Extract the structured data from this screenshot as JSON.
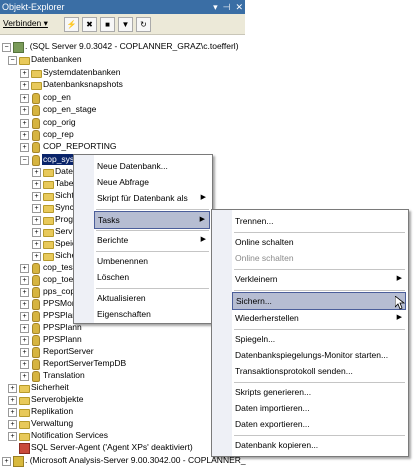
{
  "window": {
    "title": "Objekt-Explorer",
    "pin_icon": "pin-icon",
    "close_icon": "close-icon"
  },
  "toolbar": {
    "connect_label": "Verbinden ▾"
  },
  "tree": {
    "server": ". (SQL Server 9.0.3042 - COPLANNER_GRAZ\\c.toefferl)",
    "datenbanken": "Datenbanken",
    "systemdatenbanken": "Systemdatenbanken",
    "snapshots": "Datenbanksnapshots",
    "cop_en": "cop_en",
    "cop_en_stage": "cop_en_stage",
    "cop_orig": "cop_orig",
    "cop_rep": "cop_rep",
    "cop_reporting": "COP_REPORTING",
    "cop_sys": "cop_sys",
    "c1": "Date",
    "c2": "Tabe",
    "c3": "Sicht",
    "c4": "Sync",
    "c5": "Prog",
    "c6": "Serv",
    "c7": "Speic",
    "c8": "Siche",
    "cop_test": "cop_test",
    "cop_toef": "cop_toef",
    "pps_cop": "pps_cop",
    "ppsmon": "PPSMonit",
    "ppsplan1": "PPSPlann",
    "ppsplan2": "PPSPlann",
    "ppsplan3": "PPSPlann",
    "reportserver": "ReportServer",
    "reportservertemp": "ReportServerTempDB",
    "translation": "Translation",
    "sicherheit": "Sicherheit",
    "serverobjekte": "Serverobjekte",
    "replikation": "Replikation",
    "verwaltung": "Verwaltung",
    "notification": "Notification Services",
    "agent": "SQL Server-Agent ('Agent XPs' deaktiviert)",
    "analysis": ". (Microsoft Analysis-Server 9.00.3042.00 - COPLANNER_"
  },
  "menu1": {
    "neue_db": "Neue Datenbank...",
    "neue_abfrage": "Neue Abfrage",
    "skript": "Skript für Datenbank als",
    "tasks": "Tasks",
    "berichte": "Berichte",
    "umbenennen": "Umbenennen",
    "loeschen": "Löschen",
    "aktualisieren": "Aktualisieren",
    "eigenschaften": "Eigenschaften"
  },
  "menu2": {
    "trennen": "Trennen...",
    "online": "Online schalten",
    "offline": "Online schalten",
    "verkleinern": "Verkleinern",
    "sichern": "Sichern...",
    "wiederherstellen": "Wiederherstellen",
    "spiegeln": "Spiegeln...",
    "spiegel_monitor": "Datenbankspiegelungs-Monitor starten...",
    "transaktionsprotokoll": "Transaktionsprotokoll senden...",
    "skripts": "Skripts generieren...",
    "importieren": "Daten importieren...",
    "exportieren": "Daten exportieren...",
    "kopieren": "Datenbank kopieren..."
  }
}
